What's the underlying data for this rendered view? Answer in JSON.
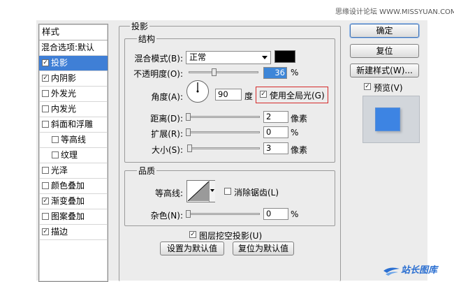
{
  "watermark": "思缘设计论坛 WWW.MISSYUAN.COM",
  "styles_panel": {
    "header": "样式",
    "items": [
      {
        "label": "混合选项:默认",
        "checkbox": false,
        "checked": false,
        "selected": false
      },
      {
        "label": "投影",
        "checkbox": true,
        "checked": true,
        "selected": true
      },
      {
        "label": "内阴影",
        "checkbox": true,
        "checked": true,
        "selected": false
      },
      {
        "label": "外发光",
        "checkbox": true,
        "checked": false,
        "selected": false
      },
      {
        "label": "内发光",
        "checkbox": true,
        "checked": false,
        "selected": false
      },
      {
        "label": "斜面和浮雕",
        "checkbox": true,
        "checked": false,
        "selected": false
      },
      {
        "label": "等高线",
        "checkbox": true,
        "checked": false,
        "selected": false,
        "indent": true
      },
      {
        "label": "纹理",
        "checkbox": true,
        "checked": false,
        "selected": false,
        "indent": true
      },
      {
        "label": "光泽",
        "checkbox": true,
        "checked": false,
        "selected": false
      },
      {
        "label": "颜色叠加",
        "checkbox": true,
        "checked": false,
        "selected": false
      },
      {
        "label": "渐变叠加",
        "checkbox": true,
        "checked": true,
        "selected": false
      },
      {
        "label": "图案叠加",
        "checkbox": true,
        "checked": false,
        "selected": false
      },
      {
        "label": "描边",
        "checkbox": true,
        "checked": true,
        "selected": false
      }
    ]
  },
  "main": {
    "section_title": "投影",
    "structure": {
      "title": "结构",
      "blend_mode_label": "混合模式(B):",
      "blend_mode_value": "正常",
      "blend_color": "#000000",
      "opacity_label": "不透明度(O):",
      "opacity_value": "36",
      "opacity_unit": "%",
      "opacity_level": 0.36,
      "angle_label": "角度(A):",
      "angle_value": "90",
      "angle_unit": "度",
      "global_light_label": "使用全局光(G)",
      "global_light_checked": true,
      "distance_label": "距离(D):",
      "distance_value": "2",
      "distance_unit": "像素",
      "spread_label": "扩展(R):",
      "spread_value": "0",
      "spread_unit": "%",
      "size_label": "大小(S):",
      "size_value": "3",
      "size_unit": "像素"
    },
    "quality": {
      "title": "品质",
      "contour_label": "等高线:",
      "antialias_label": "消除锯齿(L)",
      "antialias_checked": false,
      "noise_label": "杂色(N):",
      "noise_value": "0",
      "noise_unit": "%"
    },
    "knockout_label": "图层挖空投影(U)",
    "knockout_checked": true,
    "set_default_label": "设置为默认值",
    "reset_default_label": "复位为默认值"
  },
  "right_panel": {
    "ok_label": "确定",
    "reset_label": "复位",
    "new_style_label": "新建样式(W)...",
    "preview_label": "预览(V)",
    "preview_checked": true,
    "preview_color": "#3d84e3"
  },
  "logo": "站长图库"
}
